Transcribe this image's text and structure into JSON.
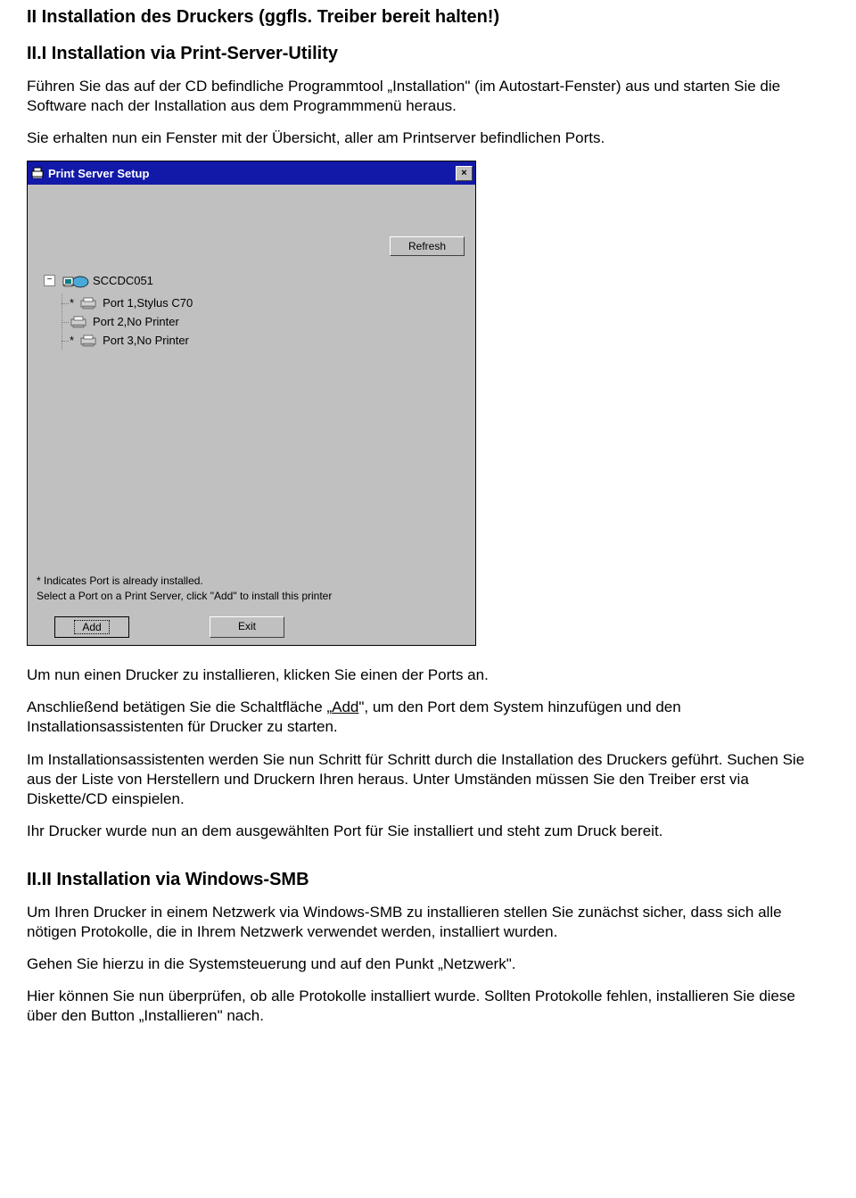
{
  "doc": {
    "h_main": "II Installation des Druckers (ggfls. Treiber bereit halten!)",
    "h_sub1": "II.I Installation via Print-Server-Utility",
    "p1": "Führen Sie das auf der CD befindliche Programmtool „Installation\" (im Autostart-Fenster) aus und starten Sie die Software nach der Installation aus dem Programmmenü heraus.",
    "p2": "Sie erhalten nun ein Fenster mit der Übersicht, aller am Printserver befindlichen Ports.",
    "p3": "Um nun einen Drucker zu installieren, klicken Sie einen der Ports an.",
    "p4a": "Anschließend betätigen Sie die Schaltfläche „",
    "p4u": "Add",
    "p4b": "\", um den Port dem System hinzufügen und den Installationsassistenten für Drucker zu starten.",
    "p5": "Im Installationsassistenten werden Sie nun Schritt für Schritt durch die Installation des Druckers geführt. Suchen Sie aus der Liste von Herstellern und Druckern Ihren heraus. Unter Umständen müssen Sie den Treiber erst via Diskette/CD einspielen.",
    "p6": "Ihr Drucker wurde nun an dem ausgewählten Port für Sie installiert und steht zum Druck bereit.",
    "h_sub2": "II.II Installation via Windows-SMB",
    "p7": "Um Ihren Drucker in einem Netzwerk via Windows-SMB zu installieren stellen Sie zunächst sicher, dass sich alle nötigen Protokolle, die in Ihrem Netzwerk verwendet werden, installiert wurden.",
    "p8": "Gehen Sie hierzu in die Systemsteuerung und auf den Punkt „Netzwerk\".",
    "p9": "Hier können Sie nun überprüfen, ob alle Protokolle installiert wurde. Sollten Protokolle fehlen, installieren Sie diese über den Button „Installieren\" nach."
  },
  "dialog": {
    "title": "Print Server Setup",
    "refresh": "Refresh",
    "server": "SCCDC051",
    "ports": [
      "Port 1,Stylus C70",
      "Port 2,No Printer",
      "Port 3,No Printer"
    ],
    "hint1": "* Indicates Port is already installed.",
    "hint2": "Select a Port on a Print Server, click \"Add\" to install this printer",
    "add": "Add",
    "exit": "Exit",
    "close_x": "×"
  }
}
